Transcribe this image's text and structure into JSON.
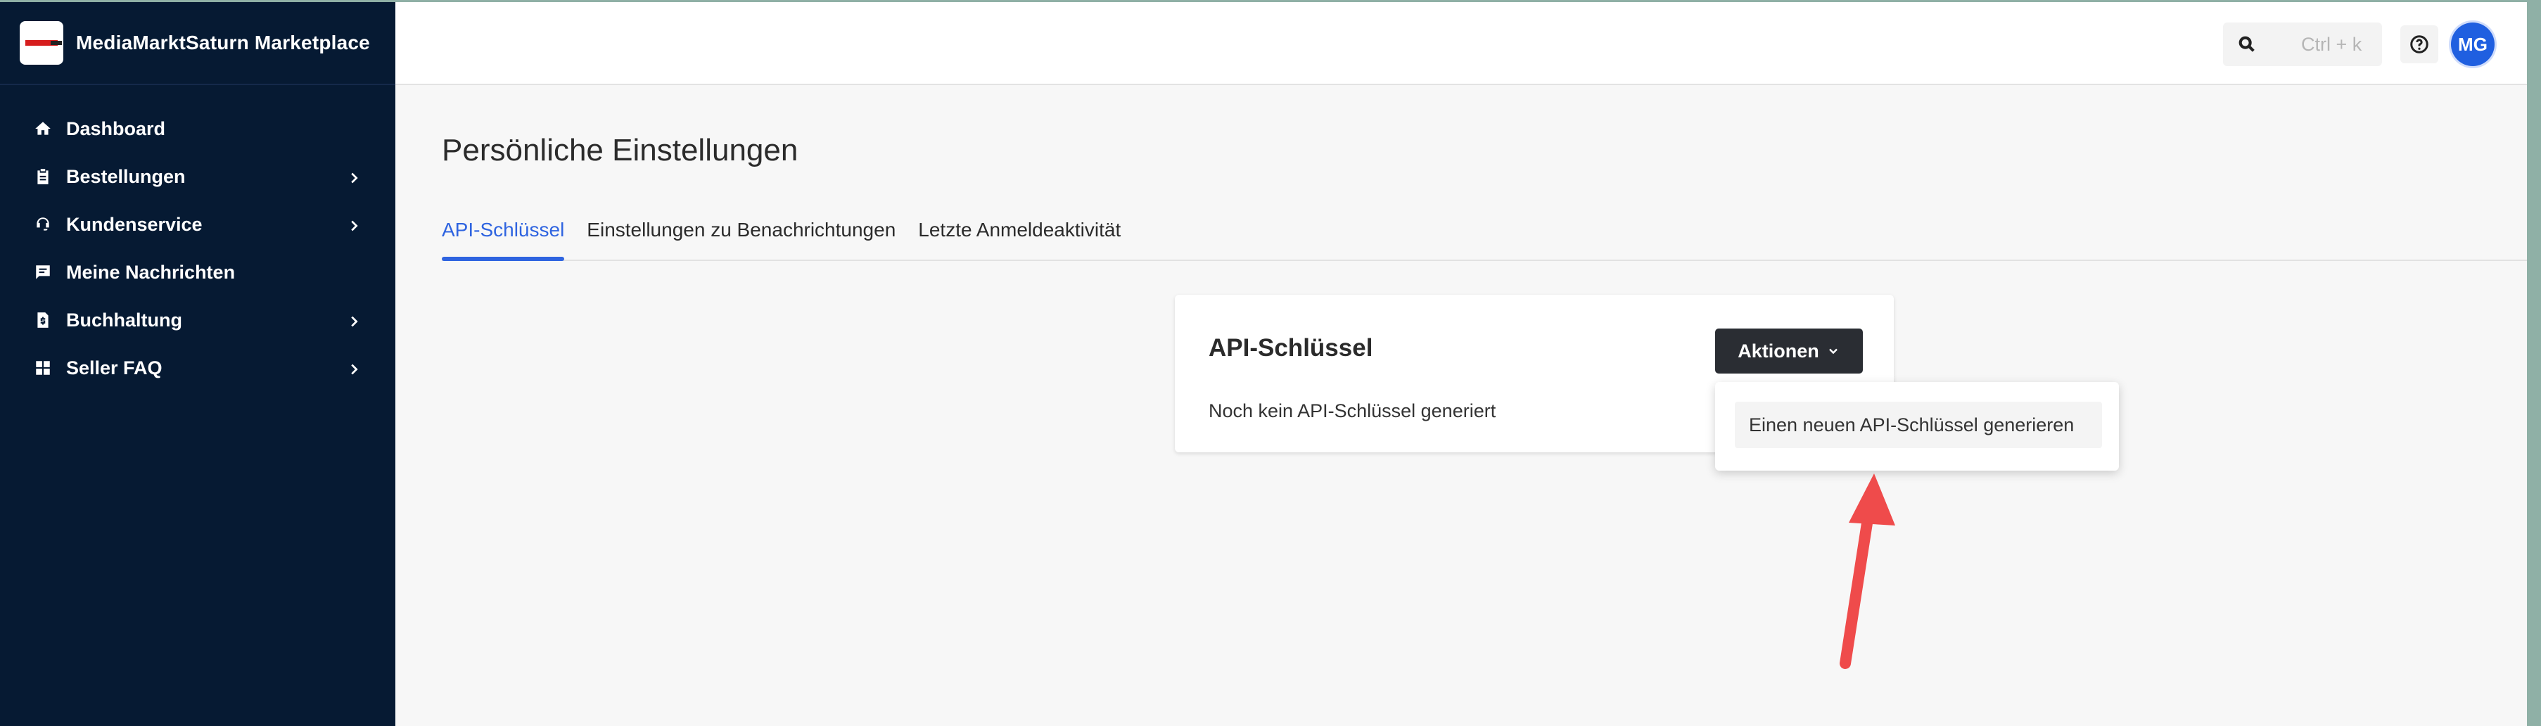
{
  "sidebar": {
    "brand_name": "MediaMarktSaturn Marketplace",
    "items": [
      {
        "label": "Dashboard",
        "icon": "home-icon",
        "has_submenu": false
      },
      {
        "label": "Bestellungen",
        "icon": "clipboard-icon",
        "has_submenu": true
      },
      {
        "label": "Kundenservice",
        "icon": "headset-icon",
        "has_submenu": true
      },
      {
        "label": "Meine Nachrichten",
        "icon": "message-icon",
        "has_submenu": false
      },
      {
        "label": "Buchhaltung",
        "icon": "invoice-icon",
        "has_submenu": true
      },
      {
        "label": "Seller FAQ",
        "icon": "grid-icon",
        "has_submenu": true
      }
    ]
  },
  "topbar": {
    "search_shortcut": "Ctrl + k",
    "avatar_initials": "MG"
  },
  "page": {
    "title": "Persönliche Einstellungen",
    "tabs": [
      {
        "label": "API-Schlüssel",
        "active": true
      },
      {
        "label": "Einstellungen zu Benachrichtungen",
        "active": false
      },
      {
        "label": "Letzte Anmeldeaktivität",
        "active": false
      }
    ]
  },
  "card": {
    "title": "API-Schlüssel",
    "empty_text": "Noch kein API-Schlüssel generiert",
    "actions_label": "Aktionen"
  },
  "dropdown": {
    "items": [
      {
        "label": "Einen neuen API-Schlüssel generieren"
      }
    ]
  },
  "colors": {
    "sidebar_bg": "#061a33",
    "accent": "#2f64e0",
    "button_dark": "#2a2d33",
    "annotation_arrow": "#ef4b4b"
  }
}
